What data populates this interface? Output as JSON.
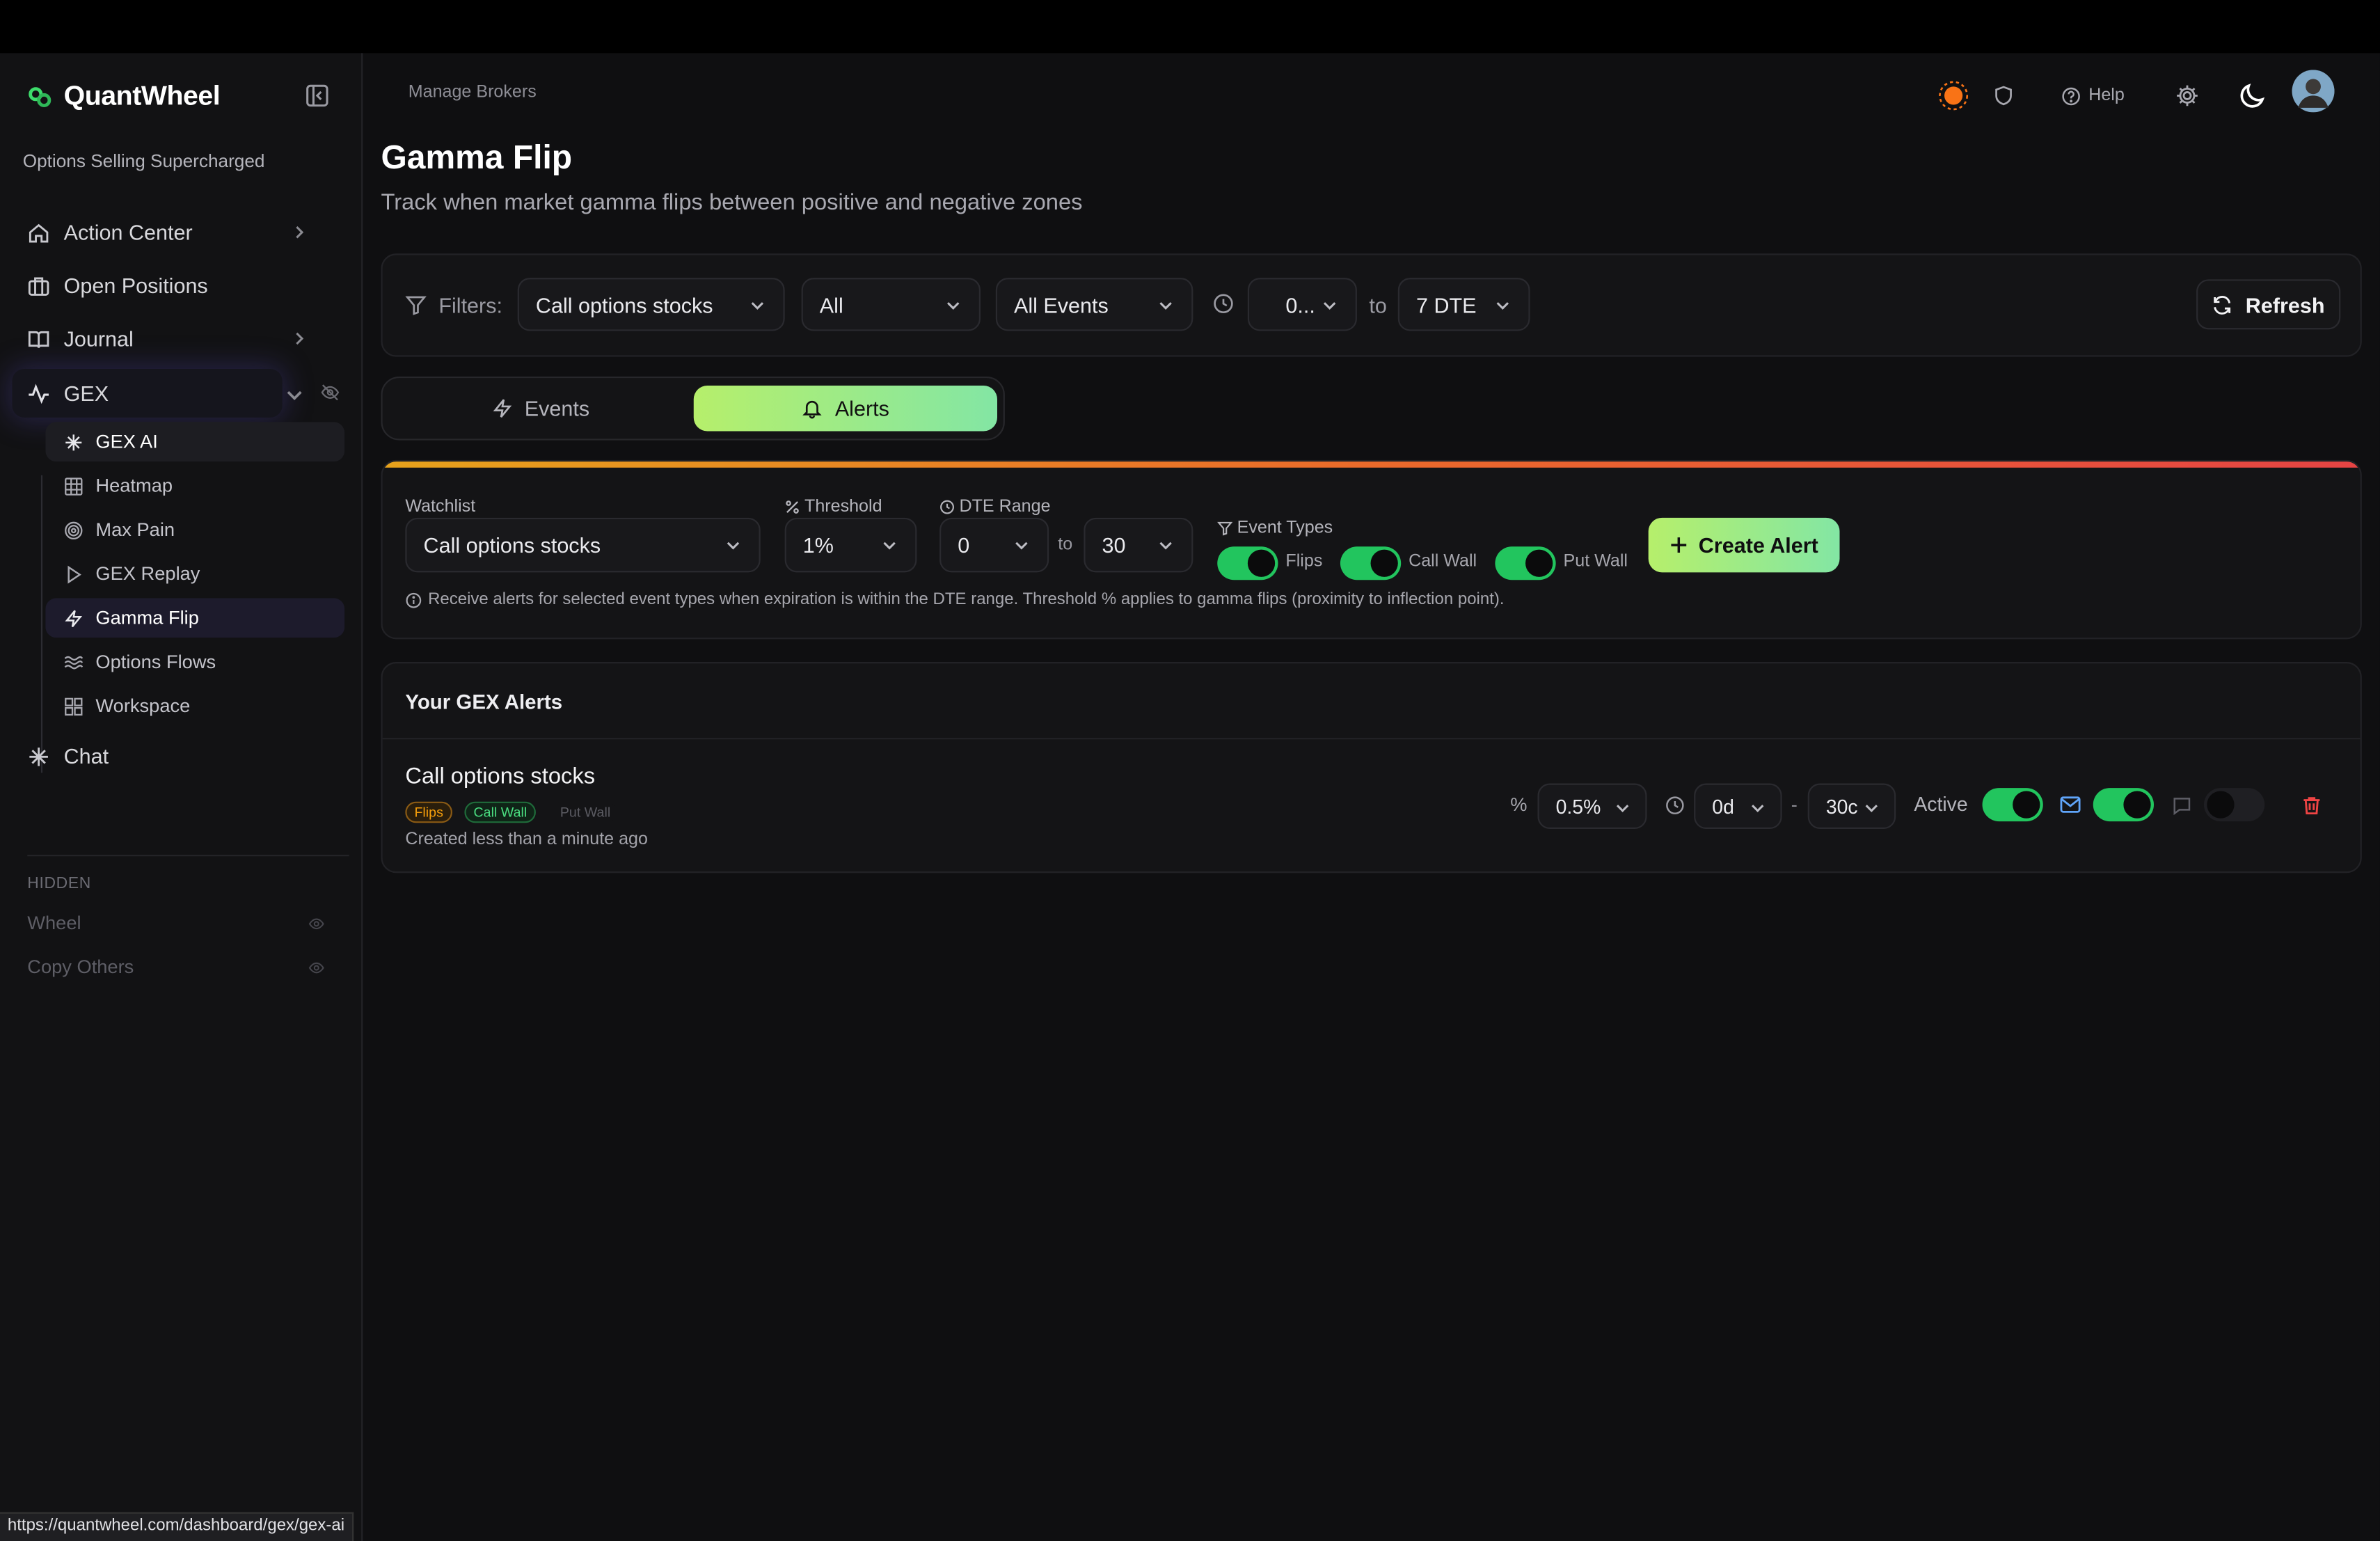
{
  "brand": {
    "name": "QuantWheel",
    "tagline": "Options Selling Supercharged"
  },
  "sidebar": {
    "items": [
      {
        "label": "Action Center"
      },
      {
        "label": "Open Positions"
      },
      {
        "label": "Journal"
      },
      {
        "label": "GEX"
      },
      {
        "label": "Chat"
      }
    ],
    "gex_sub": [
      {
        "label": "GEX AI"
      },
      {
        "label": "Heatmap"
      },
      {
        "label": "Max Pain"
      },
      {
        "label": "GEX Replay"
      },
      {
        "label": "Gamma Flip"
      },
      {
        "label": "Options Flows"
      },
      {
        "label": "Workspace"
      }
    ],
    "hidden_label": "HIDDEN",
    "hidden_items": [
      {
        "label": "Wheel"
      },
      {
        "label": "Copy Others"
      }
    ]
  },
  "status_url": "https://quantwheel.com/dashboard/gex/gex-ai",
  "header": {
    "breadcrumb": "Manage Brokers",
    "help_label": "Help"
  },
  "page": {
    "title": "Gamma Flip",
    "subtitle": "Track when market gamma flips between positive and negative zones"
  },
  "filters": {
    "label": "Filters:",
    "watchlist": "Call options stocks",
    "direction": "All",
    "event_type": "All Events",
    "dte_from": "0...",
    "to_label": "to",
    "dte_to": "7 DTE",
    "refresh_label": "Refresh"
  },
  "tabs": [
    {
      "label": "Events"
    },
    {
      "label": "Alerts"
    }
  ],
  "alert_form": {
    "watchlist_label": "Watchlist",
    "watchlist_value": "Call options stocks",
    "threshold_label": "Threshold",
    "threshold_value": "1%",
    "dte_label": "DTE Range",
    "dte_from": "0",
    "to_label": "to",
    "dte_to": "30",
    "event_types_label": "Event Types",
    "toggles": [
      {
        "label": "Flips",
        "on": true
      },
      {
        "label": "Call Wall",
        "on": true
      },
      {
        "label": "Put Wall",
        "on": true
      }
    ],
    "create_label": "Create Alert",
    "note": "Receive alerts for selected event types when expiration is within the DTE range. Threshold % applies to gamma flips (proximity to inflection point)."
  },
  "alerts_list": {
    "title": "Your GEX Alerts",
    "rows": [
      {
        "name": "Call options stocks",
        "badges": [
          "Flips",
          "Call Wall",
          "Put Wall"
        ],
        "created": "Created less than a minute ago",
        "pct_symbol": "%",
        "threshold": "0.5%",
        "dte_from": "0d",
        "dash": "-",
        "dte_to": "30c",
        "active_label": "Active",
        "active_on": true,
        "email_on": true,
        "sms_on": false
      }
    ]
  },
  "colors": {
    "accent_green": "#22c55e",
    "gradient_start": "#b6ef6b",
    "gradient_end": "#83e6a4",
    "danger": "#ef4444",
    "orange": "#f97316"
  }
}
